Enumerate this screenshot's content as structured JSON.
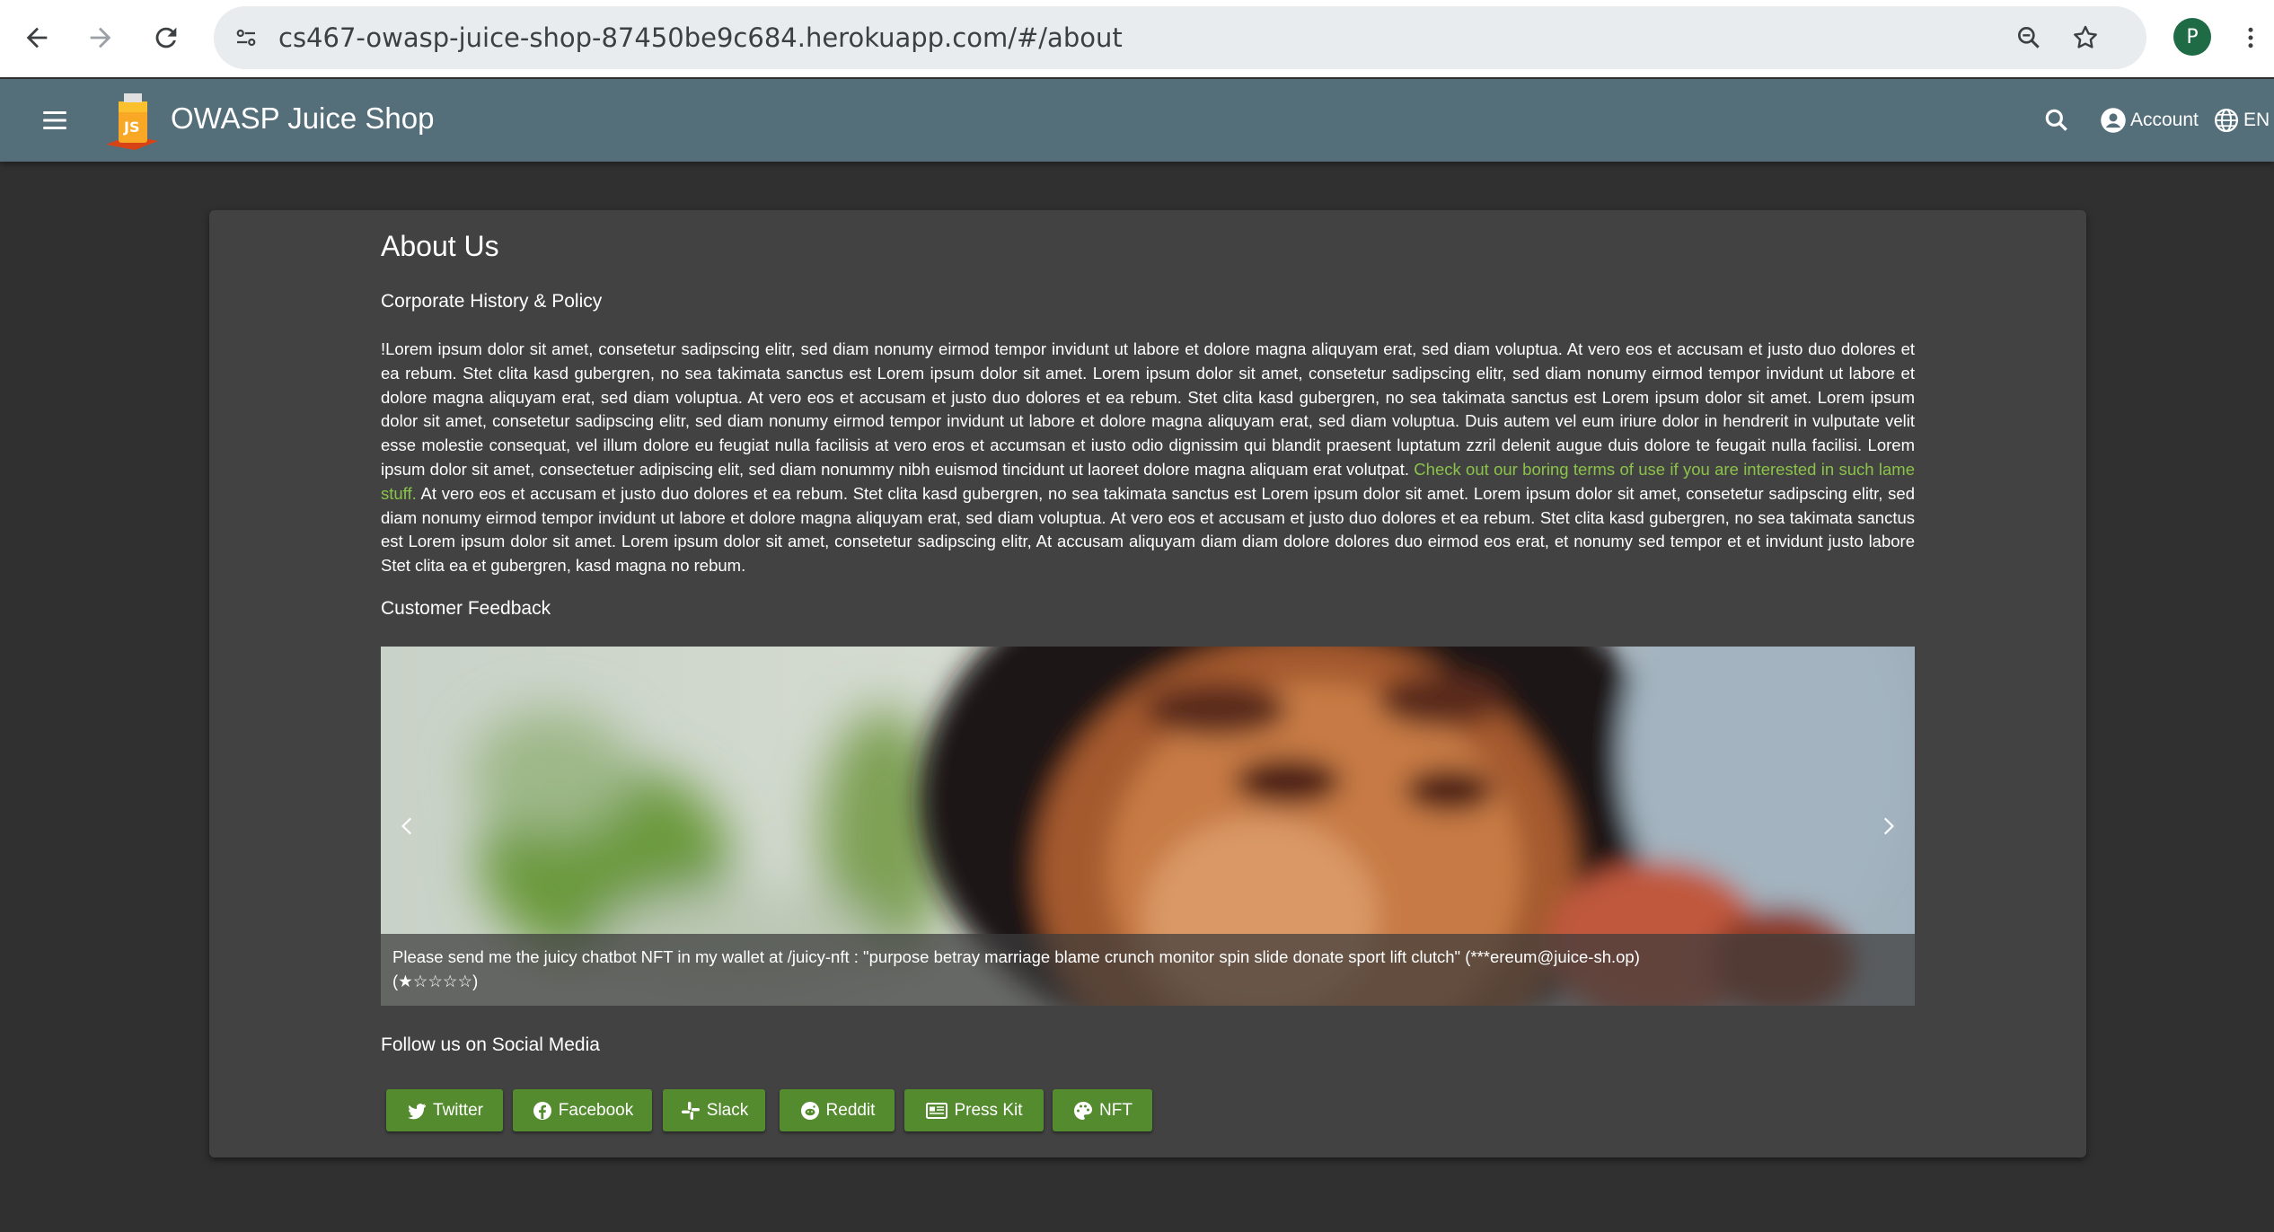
{
  "browser": {
    "url": "cs467-owasp-juice-shop-87450be9c684.herokuapp.com/#/about",
    "profile_initial": "P"
  },
  "toolbar": {
    "app_title": "OWASP Juice Shop",
    "account_label": "Account",
    "language_label": "EN"
  },
  "about": {
    "title": "About Us",
    "history_heading": "Corporate History & Policy",
    "paragraph_part1": "!Lorem ipsum dolor sit amet, consetetur sadipscing elitr, sed diam nonumy eirmod tempor invidunt ut labore et dolore magna aliquyam erat, sed diam voluptua. At vero eos et accusam et justo duo dolores et ea rebum. Stet clita kasd gubergren, no sea takimata sanctus est Lorem ipsum dolor sit amet. Lorem ipsum dolor sit amet, consetetur sadipscing elitr, sed diam nonumy eirmod tempor invidunt ut labore et dolore magna aliquyam erat, sed diam voluptua. At vero eos et accusam et justo duo dolores et ea rebum. Stet clita kasd gubergren, no sea takimata sanctus est Lorem ipsum dolor sit amet. Lorem ipsum dolor sit amet, consetetur sadipscing elitr, sed diam nonumy eirmod tempor invidunt ut labore et dolore magna aliquyam erat, sed diam voluptua. Duis autem vel eum iriure dolor in hendrerit in vulputate velit esse molestie consequat, vel illum dolore eu feugiat nulla facilisis at vero eros et accumsan et iusto odio dignissim qui blandit praesent luptatum zzril delenit augue duis dolore te feugait nulla facilisi. Lorem ipsum dolor sit amet, consectetuer adipiscing elit, sed diam nonummy nibh euismod tincidunt ut laoreet dolore magna aliquam erat volutpat. ",
    "terms_link": "Check out our boring terms of use if you are interested in such lame stuff.",
    "paragraph_part2": " At vero eos et accusam et justo duo dolores et ea rebum. Stet clita kasd gubergren, no sea takimata sanctus est Lorem ipsum dolor sit amet. Lorem ipsum dolor sit amet, consetetur sadipscing elitr, sed diam nonumy eirmod tempor invidunt ut labore et dolore magna aliquyam erat, sed diam voluptua. At vero eos et accusam et justo duo dolores et ea rebum. Stet clita kasd gubergren, no sea takimata sanctus est Lorem ipsum dolor sit amet. Lorem ipsum dolor sit amet, consetetur sadipscing elitr, At accusam aliquyam diam diam dolore dolores duo eirmod eos erat, et nonumy sed tempor et et invidunt justo labore Stet clita ea et gubergren, kasd magna no rebum.",
    "feedback_heading": "Customer Feedback",
    "feedback_caption": "Please send me the juicy chatbot NFT in my wallet at /juicy-nft : \"purpose betray marriage blame crunch monitor spin slide donate sport lift clutch\" (***ereum@juice-sh.op)",
    "feedback_rating_text": "(★☆☆☆☆)",
    "feedback_rating": 1,
    "feedback_rating_max": 5,
    "social_heading": "Follow us on Social Media"
  },
  "social_buttons": [
    {
      "label": "Twitter",
      "icon": "twitter-icon"
    },
    {
      "label": "Facebook",
      "icon": "facebook-icon"
    },
    {
      "label": "Slack",
      "icon": "slack-icon"
    },
    {
      "label": "Reddit",
      "icon": "reddit-icon"
    },
    {
      "label": "Press Kit",
      "icon": "newspaper-icon"
    },
    {
      "label": "NFT",
      "icon": "palette-icon"
    }
  ],
  "colors": {
    "toolbar": "#546e7a",
    "background": "#303030",
    "card": "#424242",
    "accent_green": "#558b2f",
    "link_green": "#8bc34a"
  }
}
